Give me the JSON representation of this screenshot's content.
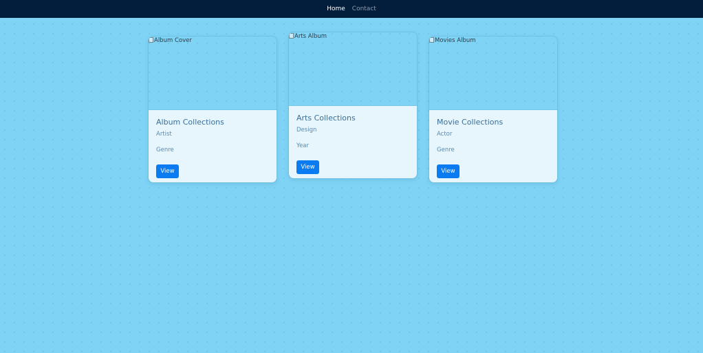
{
  "nav": {
    "items": [
      {
        "label": "Home",
        "active": true
      },
      {
        "label": "Contact",
        "active": false
      }
    ]
  },
  "cards": [
    {
      "img_alt": "Album Cover",
      "title": "Album Collections",
      "line1": "Artist",
      "line2": "Genre",
      "button": "View"
    },
    {
      "img_alt": "Arts Album",
      "title": "Arts Collections",
      "line1": "Design",
      "line2": "Year",
      "button": "View"
    },
    {
      "img_alt": "Movies Album",
      "title": "Movie Collections",
      "line1": "Actor",
      "line2": "Genre",
      "button": "View"
    }
  ],
  "colors": {
    "navbar": "#031e3c",
    "page_background": "#7fd3f5",
    "card_body": "#e6f6fc",
    "button": "#0a7bf0"
  }
}
